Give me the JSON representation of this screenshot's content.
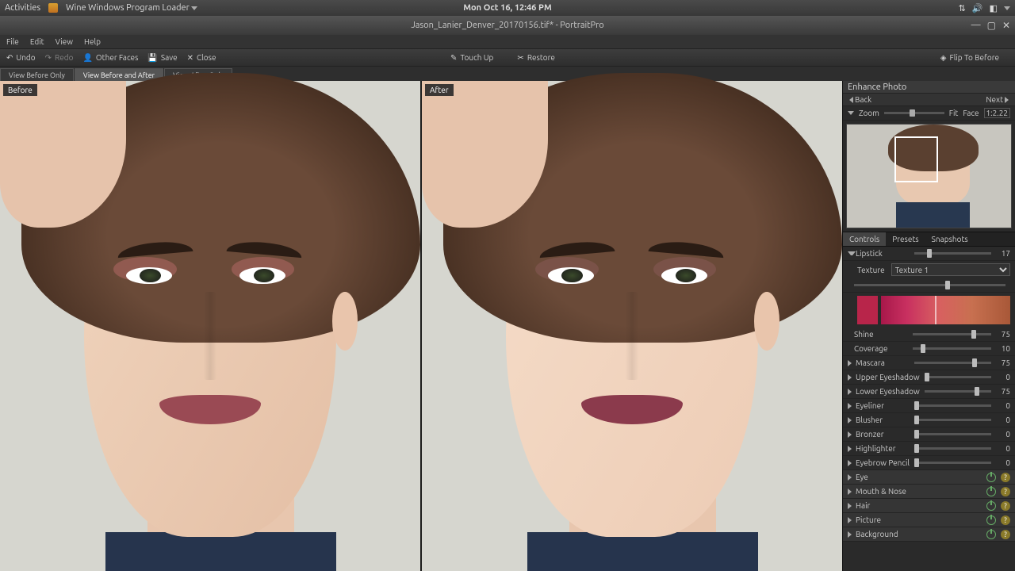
{
  "os": {
    "activities": "Activities",
    "app": "Wine Windows Program Loader",
    "clock": "Mon Oct 16, 12:46 PM"
  },
  "window": {
    "title": "Jason_Lanier_Denver_20170156.tif* - PortraitPro"
  },
  "menu": {
    "file": "File",
    "edit": "Edit",
    "view": "View",
    "help": "Help"
  },
  "toolbar": {
    "undo": "Undo",
    "redo": "Redo",
    "other_faces": "Other Faces",
    "save": "Save",
    "close": "Close",
    "touch_up": "Touch Up",
    "restore": "Restore",
    "flip": "Flip To Before"
  },
  "viewtabs": {
    "before_only": "View Before Only",
    "before_after": "View Before and After",
    "after_only": "View After Only"
  },
  "canvas": {
    "before": "Before",
    "after": "After"
  },
  "sidebar": {
    "title": "Enhance Photo",
    "back": "Back",
    "next": "Next",
    "zoom": "Zoom",
    "fit": "Fit",
    "face": "Face",
    "ratio": "1:2.22",
    "tabs": {
      "controls": "Controls",
      "presets": "Presets",
      "snapshots": "Snapshots"
    }
  },
  "makeup": {
    "lipstick": {
      "label": "Lipstick",
      "value": 17
    },
    "texture_label": "Texture",
    "texture_value": "Texture 1",
    "shine": {
      "label": "Shine",
      "value": 75
    },
    "coverage": {
      "label": "Coverage",
      "value": 10
    },
    "mascara": {
      "label": "Mascara",
      "value": 75
    },
    "upper_eyeshadow": {
      "label": "Upper Eyeshadow",
      "value": 0
    },
    "lower_eyeshadow": {
      "label": "Lower Eyeshadow",
      "value": 75
    },
    "eyeliner": {
      "label": "Eyeliner",
      "value": 0
    },
    "blusher": {
      "label": "Blusher",
      "value": 0
    },
    "bronzer": {
      "label": "Bronzer",
      "value": 0
    },
    "highlighter": {
      "label": "Highlighter",
      "value": 0
    },
    "eyebrow_pencil": {
      "label": "Eyebrow Pencil",
      "value": 0
    }
  },
  "sections": {
    "eye": "Eye",
    "mouth_nose": "Mouth & Nose",
    "hair": "Hair",
    "picture": "Picture",
    "background": "Background"
  },
  "colors": {
    "lip_before": "#9a4a54",
    "lip_after": "#8b3a4c",
    "shadow_before": "#b86a68",
    "shadow_after": "#8a5a58"
  }
}
